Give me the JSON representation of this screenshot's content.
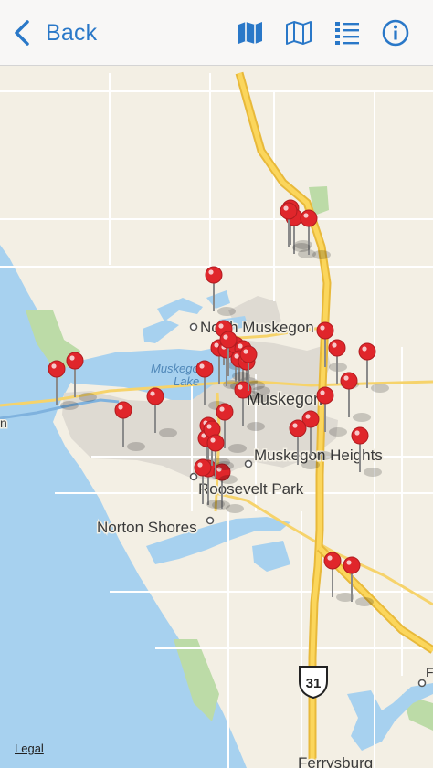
{
  "nav": {
    "back_label": "Back",
    "icons": [
      "map-filled-icon",
      "map-outline-icon",
      "list-icon",
      "info-icon"
    ],
    "accent_color": "#2a78c8"
  },
  "map": {
    "labels": {
      "north_muskegon": "North Muskegon",
      "muskegon_lake": "Muskegon",
      "muskegon_lake_2": "Lake",
      "muskegon": "Muskegon",
      "muskegon_heights": "Muskegon Heights",
      "roosevelt_park": "Roosevelt Park",
      "norton_shores": "Norton Shores",
      "ferrysburg": "Ferrysburg",
      "route_31": "31",
      "edge_letter": "n",
      "edge_letter_right": "F"
    },
    "pin_color": "#e0262b",
    "pin_count": 38
  },
  "footer": {
    "legal": "Legal"
  }
}
